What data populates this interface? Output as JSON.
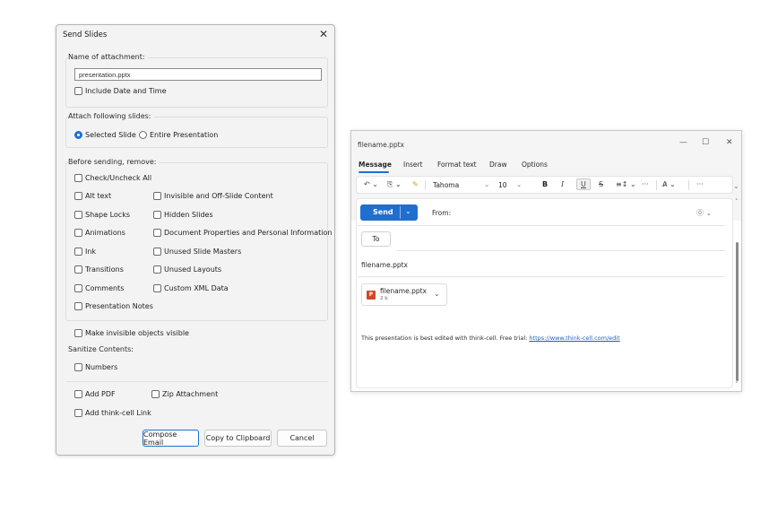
{
  "dialog": {
    "title": "Send Slides",
    "close_glyph": "✕",
    "attachment_group": {
      "title": "Name of attachment:",
      "value": "presentation.pptx",
      "include_date_time": "Include Date and Time"
    },
    "attach_group": {
      "title": "Attach following slides:",
      "selected_slide": "Selected Slide",
      "entire_presentation": "Entire Presentation",
      "selected": "Selected Slide"
    },
    "remove_group": {
      "title": "Before sending, remove:",
      "check_all": "Check/Uncheck All",
      "left": [
        "Alt text",
        "Shape Locks",
        "Animations",
        "Ink",
        "Transitions",
        "Comments",
        "Presentation Notes"
      ],
      "right": [
        "Invisible and Off-Slide Content",
        "Hidden Slides",
        "Document Properties and Personal Information",
        "Unused Slide Masters",
        "Unused Layouts",
        "Custom XML Data"
      ]
    },
    "make_visible": "Make invisible objects visible",
    "sanitize": {
      "title": "Sanitize Contents:",
      "numbers": "Numbers"
    },
    "add_pdf": "Add PDF",
    "zip_attachment": "Zip Attachment",
    "add_link": "Add think-cell Link",
    "buttons": {
      "compose": "Compose Email",
      "copy": "Copy to Clipboard",
      "cancel": "Cancel"
    }
  },
  "mail": {
    "window_title": "filename.pptx",
    "controls": {
      "minimize": "—",
      "maximize": "☐",
      "close": "✕"
    },
    "tabs": [
      "Message",
      "Insert",
      "Format text",
      "Draw",
      "Options"
    ],
    "active_tab": "Message",
    "ribbon": {
      "undo": "↶ ⌄",
      "paste": "⎘ ⌄",
      "marker": "✎",
      "font": "Tahoma",
      "font_caret": "⌄",
      "size": "10",
      "size_caret": "⌄",
      "bold": "B",
      "italic": "I",
      "underline": "U",
      "strike": "S",
      "list": "≡↕ ⌄",
      "more": "···",
      "styles": "A̷ ⌄",
      "more2": "···",
      "collapse": "⌄"
    },
    "send": "Send",
    "send_caret": "⌄",
    "from": "From:",
    "help": "⓪ ⌄",
    "to": "To",
    "subject": "filename.pptx",
    "attachment": {
      "name": "filename.pptx",
      "size": "2 b",
      "caret": "⌄",
      "icon": "P"
    },
    "body_text": "This presentation is best edited with think-cell. Free trial: ",
    "body_link": "https://www.think-cell.com/edit",
    "scroll_up": "˄",
    "scroll_down": "˅"
  },
  "colors": {
    "accent": "#1f6fd1",
    "powerpoint": "#d24726"
  }
}
